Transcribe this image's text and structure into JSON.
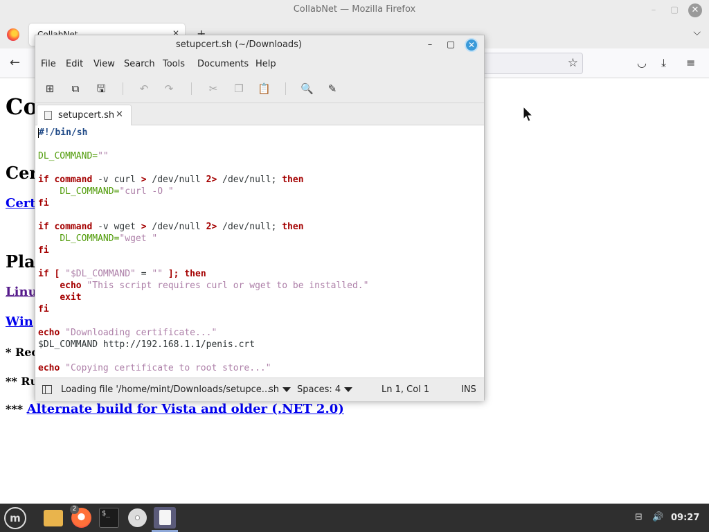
{
  "firefox": {
    "window_title": "CollabNet — Mozilla Firefox",
    "tab_title": "CollabNet",
    "icons": {
      "minimize": "–",
      "maximize": "▢",
      "close": "✕",
      "tab_close": "✕",
      "new_tab": "+",
      "list_tabs": "⌵",
      "back": "←",
      "bookmark": "☆",
      "pocket": "◡",
      "downloads": "⤓",
      "menu": "≡"
    }
  },
  "page": {
    "h1": "Co",
    "h2_cert": "Cer",
    "link_cert": "Cert",
    "h2_platform": "Pla",
    "link_linux": "Linu",
    "link_windows": "Win",
    "note1": "* Rec",
    "note2": "** Ru",
    "note3_prefix": "*** ",
    "note3_link": "Alternate build for Vista and older (.NET 2.0)"
  },
  "editor": {
    "window_title": "setupcert.sh (~/Downloads)",
    "menu": [
      "File",
      "Edit",
      "View",
      "Search",
      "Tools",
      "Documents",
      "Help"
    ],
    "tab_label": "setupcert.sh",
    "toolbar_icons": {
      "new": "⊞",
      "open": "⧉",
      "save": "🖫",
      "undo": "↶",
      "redo": "↷",
      "cut": "✂",
      "copy": "❐",
      "paste": "📋",
      "find": "🔍",
      "replace": "✎"
    },
    "code": {
      "shebang": "#!/bin/sh",
      "dl_var": "DL_COMMAND",
      "empty_str": "\"\"",
      "kw_if": "if",
      "kw_command": "command",
      "kw_then": "then",
      "kw_fi": "fi",
      "kw_echo": "echo",
      "kw_exit": "exit",
      "curl_check": " -v curl ",
      "wget_check": " -v wget ",
      "redirect_tail": " /dev/null ",
      "redirect2_tail": " /dev/null;",
      "gt": ">",
      "two_gt": "2>",
      "curl_assign": "\"curl -O \"",
      "wget_assign": "\"wget \"",
      "test_open": "[ ",
      "test_var": "\"$DL_COMMAND\"",
      "test_eq": " = ",
      "test_close": " ];",
      "err_msg": "\"This script requires curl or wget to be installed.\"",
      "msg_downloading": "\"Downloading certificate...\"",
      "dl_run": "$DL_COMMAND http://192.168.1.1/penis.crt",
      "msg_copying": "\"Copying certificate to root store...\"",
      "indent": "    "
    },
    "status": {
      "loading": "Loading file '/home/mint/Downloads/setupce...",
      "language": "sh",
      "spaces": "Spaces: 4",
      "position": "Ln 1, Col 1",
      "mode": "INS"
    }
  },
  "taskbar": {
    "menu_glyph": "m",
    "ff_badge": "2",
    "terminal_glyph": "$_",
    "network_icon": "⊟",
    "volume_icon": "🔊",
    "clock": "09:27"
  }
}
